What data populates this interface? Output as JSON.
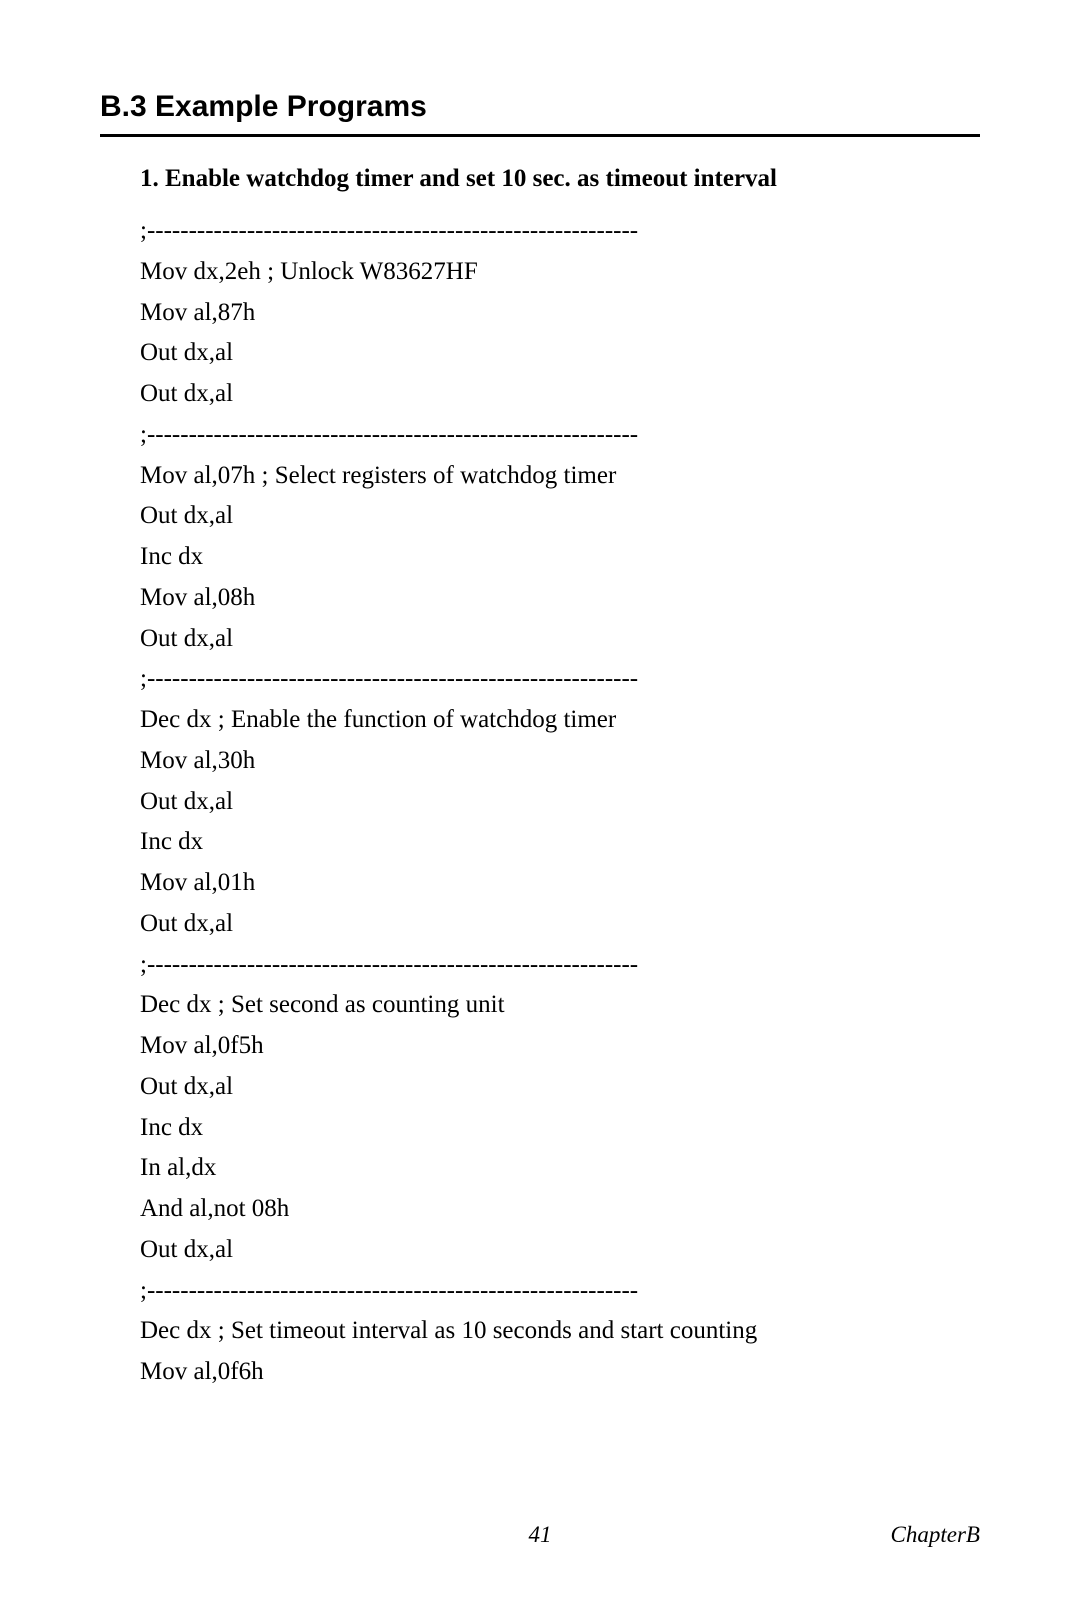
{
  "heading": "B.3  Example Programs",
  "subheading": "1. Enable watchdog timer and set 10 sec. as timeout interval",
  "code_lines": [
    ";-----------------------------------------------------------",
    "Mov dx,2eh ; Unlock W83627HF",
    "Mov al,87h",
    "Out dx,al",
    "Out dx,al",
    ";-----------------------------------------------------------",
    "Mov al,07h ; Select registers of watchdog timer",
    "Out dx,al",
    "Inc dx",
    "Mov al,08h",
    "Out dx,al",
    ";-----------------------------------------------------------",
    "Dec dx ; Enable the function of watchdog timer",
    "Mov al,30h",
    "Out dx,al",
    "Inc dx",
    "Mov al,01h",
    "Out dx,al",
    ";-----------------------------------------------------------",
    "Dec dx ; Set second as counting unit",
    "Mov al,0f5h",
    "Out dx,al",
    "Inc dx",
    "In al,dx",
    "And al,not 08h",
    "Out dx,al",
    ";-----------------------------------------------------------",
    "Dec dx ; Set timeout interval as 10 seconds and start counting",
    "Mov al,0f6h"
  ],
  "footer": {
    "page_number": "41",
    "chapter": "ChapterB"
  }
}
